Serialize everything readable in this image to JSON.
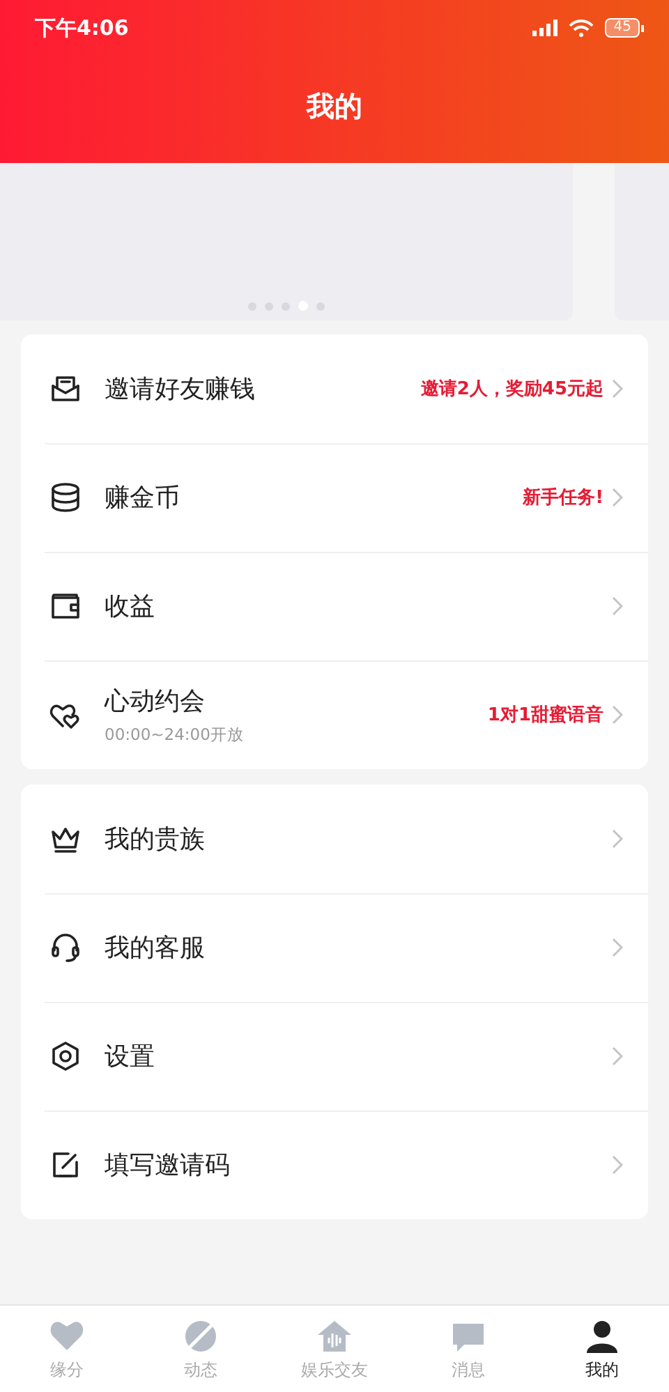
{
  "status_bar": {
    "time": "下午4:06",
    "battery": "45"
  },
  "header": {
    "title": "我的"
  },
  "banner": {
    "dots": [
      {
        "selected": false
      },
      {
        "selected": false
      },
      {
        "selected": false
      },
      {
        "selected": true
      },
      {
        "selected": false
      }
    ]
  },
  "menu_groups": [
    {
      "items": [
        {
          "label": "邀请好友赚钱",
          "note": "邀请2人，奖励45元起"
        },
        {
          "label": "赚金币",
          "note": "新手任务!"
        },
        {
          "label": "收益"
        },
        {
          "label": "心动约会",
          "subtitle": "00:00~24:00开放",
          "note": "1对1甜蜜语音"
        }
      ]
    },
    {
      "items": [
        {
          "label": "我的贵族"
        },
        {
          "label": "我的客服"
        },
        {
          "label": "设置"
        },
        {
          "label": "填写邀请码"
        }
      ]
    }
  ],
  "tab_bar": [
    {
      "label": "缘分",
      "selected": false
    },
    {
      "label": "动态",
      "selected": false
    },
    {
      "label": "娱乐交友",
      "selected": false
    },
    {
      "label": "消息",
      "selected": false
    },
    {
      "label": "我的",
      "selected": true
    }
  ]
}
